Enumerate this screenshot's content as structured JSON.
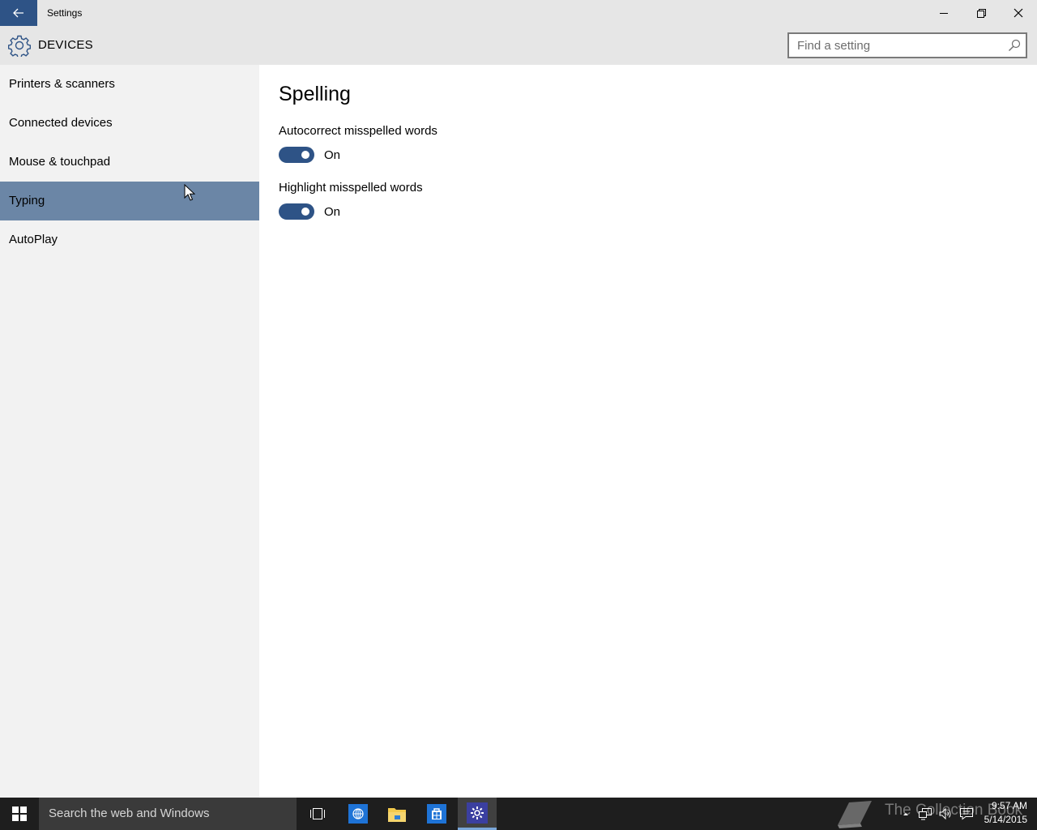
{
  "window": {
    "title": "Settings",
    "controls": [
      "minimize",
      "restore",
      "close"
    ]
  },
  "header": {
    "category_icon": "gear-icon",
    "category": "DEVICES",
    "search": {
      "placeholder": "Find a setting",
      "value": "",
      "icon": "search-icon"
    }
  },
  "sidebar": {
    "items": [
      {
        "label": "Printers & scanners",
        "selected": false
      },
      {
        "label": "Connected devices",
        "selected": false
      },
      {
        "label": "Mouse & touchpad",
        "selected": false
      },
      {
        "label": "Typing",
        "selected": true
      },
      {
        "label": "AutoPlay",
        "selected": false
      }
    ]
  },
  "main": {
    "section_title": "Spelling",
    "settings": [
      {
        "label": "Autocorrect misspelled words",
        "state": "On",
        "enabled": true
      },
      {
        "label": "Highlight misspelled words",
        "state": "On",
        "enabled": true
      }
    ]
  },
  "taskbar": {
    "search_placeholder": "Search the web and Windows",
    "apps": [
      "task-view-icon",
      "internet-explorer-icon",
      "file-explorer-icon",
      "store-icon",
      "settings-icon"
    ],
    "watermark": "The Collection Book",
    "tray": [
      "chevron-up-icon",
      "network-icon",
      "volume-icon",
      "action-center-icon"
    ],
    "time": "9:57 AM",
    "date": "5/14/2015"
  },
  "colors": {
    "accent": "#2e5386",
    "selected_nav": "#6b86a6",
    "titlebar": "#e6e6e6",
    "sidebar": "#f2f2f2",
    "taskbar": "#1e1e1e"
  }
}
